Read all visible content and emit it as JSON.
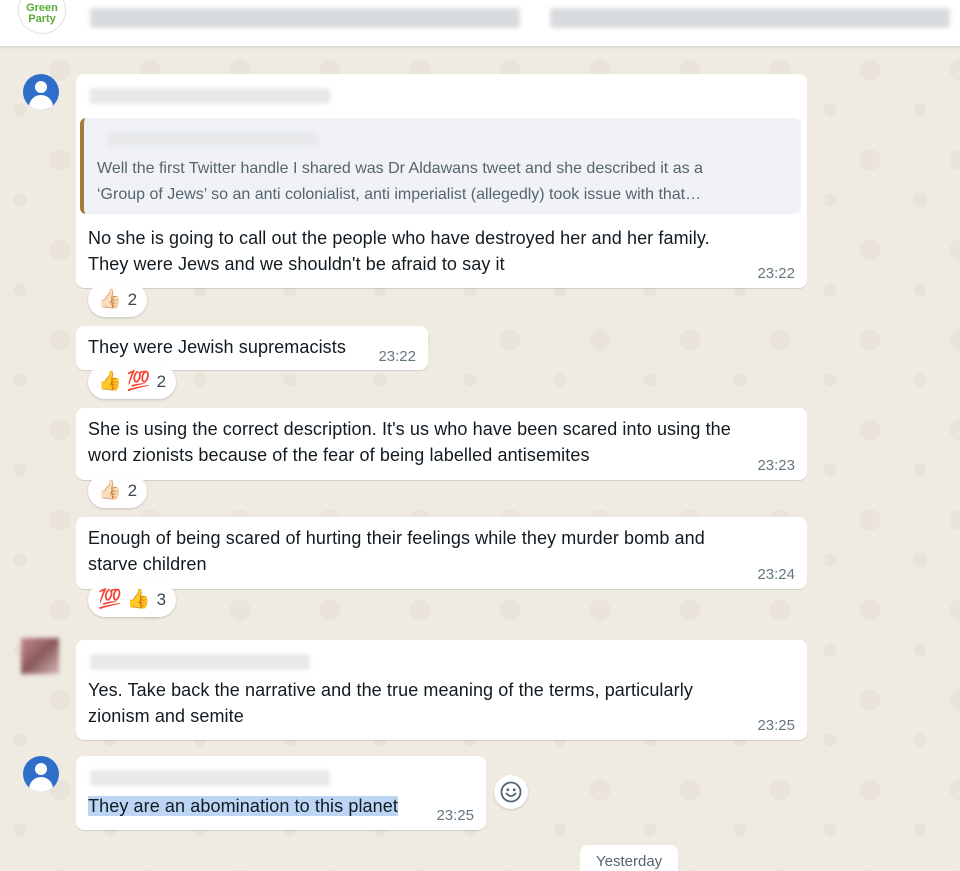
{
  "header": {
    "logo_line1": "Green",
    "logo_line2": "Party"
  },
  "messages": [
    {
      "quote_text_1": "Well the first Twitter handle I shared was Dr Aldawans tweet and she described it as a",
      "quote_text_2": "‘Group of Jews’ so an anti colonialist, anti imperialist (allegedly) took issue with that…",
      "line1": "No she is going to call out the people who have destroyed her and her family.",
      "line2": "They were Jews and we shouldn't be afraid to say it",
      "time": "23:22",
      "reaction": {
        "emojis": "👍🏻",
        "count": "2"
      }
    },
    {
      "line1": "They were Jewish supremacists",
      "time": "23:22",
      "reaction": {
        "emojis": "👍 💯",
        "count": "2"
      }
    },
    {
      "line1": "She is using the correct description. It's us who have been scared into using the",
      "line2": "word zionists because of the fear of being labelled antisemites",
      "time": "23:23",
      "reaction": {
        "emojis": "👍🏻",
        "count": "2"
      }
    },
    {
      "line1": "Enough of being scared of hurting their feelings while they murder bomb and",
      "line2": "starve children",
      "time": "23:24",
      "reaction": {
        "emojis": "💯 👍",
        "count": "3"
      }
    },
    {
      "line1": "Yes. Take back the narrative and the true meaning of the terms, particularly",
      "line2": "zionism and semite",
      "time": "23:25"
    },
    {
      "line1": "They are an abomination to this planet",
      "time": "23:25"
    }
  ],
  "date_chip": "Yesterday",
  "colors": {
    "wallpaper": "#efeae2",
    "bubble": "#ffffff",
    "quote_bar": "#a57b3d",
    "avatar": "#2d6fc9",
    "selection": "#bcd5f5"
  },
  "icons": {
    "reply_emoji": "smiley-icon",
    "avatar": "default-user-icon"
  }
}
